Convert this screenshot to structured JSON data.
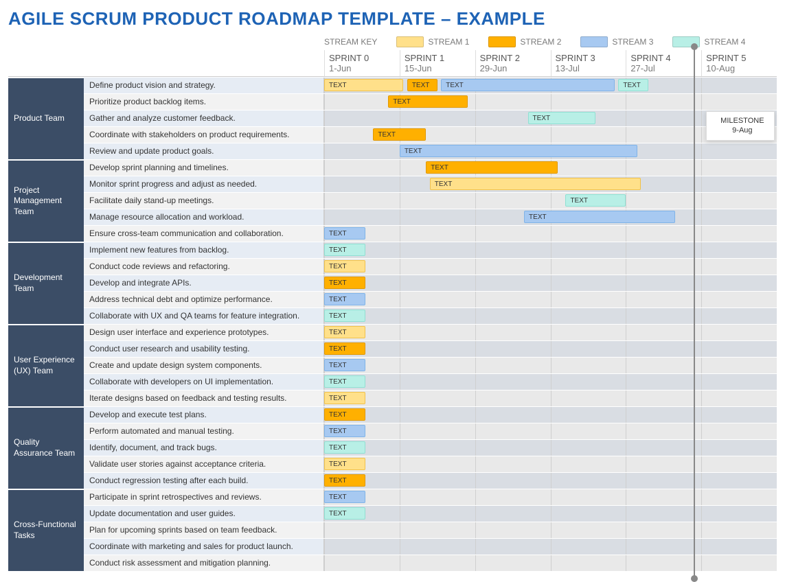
{
  "title": "AGILE SCRUM PRODUCT ROADMAP TEMPLATE – EXAMPLE",
  "legend": {
    "label": "STREAM KEY",
    "items": [
      {
        "name": "STREAM 1",
        "color": "#ffe08a"
      },
      {
        "name": "STREAM 2",
        "color": "#ffb000"
      },
      {
        "name": "STREAM 3",
        "color": "#a7c9f1"
      },
      {
        "name": "STREAM 4",
        "color": "#b8efe6"
      }
    ]
  },
  "sprints": [
    "SPRINT 0",
    "SPRINT 1",
    "SPRINT 2",
    "SPRINT 3",
    "SPRINT 4",
    "SPRINT 5"
  ],
  "dates": [
    "1-Jun",
    "15-Jun",
    "29-Jun",
    "13-Jul",
    "27-Jul",
    "10-Aug"
  ],
  "milestone": {
    "label": "MILESTONE",
    "date": "9-Aug",
    "sprint_position": 4.9
  },
  "groups": [
    {
      "name": "Product Team",
      "tasks": [
        "Define product vision and strategy.",
        "Prioritize product backlog items.",
        "Gather and analyze customer feedback.",
        "Coordinate with stakeholders on product requirements.",
        "Review and update product goals."
      ]
    },
    {
      "name": "Project Management Team",
      "tasks": [
        "Develop sprint planning and timelines.",
        "Monitor sprint progress and adjust as needed.",
        "Facilitate daily stand-up meetings.",
        "Manage resource allocation and workload.",
        "Ensure cross-team communication and collaboration."
      ]
    },
    {
      "name": "Development Team",
      "tasks": [
        "Implement new features from backlog.",
        "Conduct code reviews and refactoring.",
        "Develop and integrate APIs.",
        "Address technical debt and optimize performance.",
        "Collaborate with UX and QA teams for feature integration."
      ]
    },
    {
      "name": "User Experience (UX) Team",
      "tasks": [
        "Design user interface and experience prototypes.",
        "Conduct user research and usability testing.",
        "Create and update design system components.",
        "Collaborate with developers on UI implementation.",
        "Iterate designs based on feedback and testing results."
      ]
    },
    {
      "name": "Quality Assurance Team",
      "tasks": [
        "Develop and execute test plans.",
        "Perform automated and manual testing.",
        "Identify, document, and track bugs.",
        "Validate user stories against acceptance criteria.",
        "Conduct regression testing after each build."
      ]
    },
    {
      "name": "Cross-Functional Tasks",
      "tasks": [
        "Participate in sprint retrospectives and reviews.",
        "Update documentation and user guides.",
        "Plan for upcoming sprints based on team feedback.",
        "Coordinate with marketing and sales for product launch.",
        "Conduct risk assessment and mitigation planning."
      ]
    }
  ],
  "chart_data": {
    "type": "gantt",
    "x_unit": "sprint",
    "xlim": [
      0,
      6
    ],
    "bar_label": "TEXT",
    "bars": [
      {
        "row": 0,
        "stream": 1,
        "start": 0,
        "end": 1.05
      },
      {
        "row": 0,
        "stream": 2,
        "start": 1.1,
        "end": 1.5
      },
      {
        "row": 0,
        "stream": 3,
        "start": 1.55,
        "end": 3.85
      },
      {
        "row": 0,
        "stream": 4,
        "start": 3.9,
        "end": 4.3
      },
      {
        "row": 1,
        "stream": 2,
        "start": 0.85,
        "end": 1.9
      },
      {
        "row": 2,
        "stream": 4,
        "start": 2.7,
        "end": 3.6
      },
      {
        "row": 3,
        "stream": 2,
        "start": 0.65,
        "end": 1.35
      },
      {
        "row": 4,
        "stream": 3,
        "start": 1.0,
        "end": 4.15
      },
      {
        "row": 5,
        "stream": 2,
        "start": 1.35,
        "end": 3.1
      },
      {
        "row": 6,
        "stream": 1,
        "start": 1.4,
        "end": 4.2
      },
      {
        "row": 7,
        "stream": 4,
        "start": 3.2,
        "end": 4.0
      },
      {
        "row": 8,
        "stream": 3,
        "start": 2.65,
        "end": 4.65
      },
      {
        "row": 9,
        "stream": 3,
        "start": 0,
        "end": 0.55
      },
      {
        "row": 10,
        "stream": 4,
        "start": 0,
        "end": 0.55
      },
      {
        "row": 11,
        "stream": 1,
        "start": 0,
        "end": 0.55
      },
      {
        "row": 12,
        "stream": 2,
        "start": 0,
        "end": 0.55
      },
      {
        "row": 13,
        "stream": 3,
        "start": 0,
        "end": 0.55
      },
      {
        "row": 14,
        "stream": 4,
        "start": 0,
        "end": 0.55
      },
      {
        "row": 15,
        "stream": 1,
        "start": 0,
        "end": 0.55
      },
      {
        "row": 16,
        "stream": 2,
        "start": 0,
        "end": 0.55
      },
      {
        "row": 17,
        "stream": 3,
        "start": 0,
        "end": 0.55
      },
      {
        "row": 18,
        "stream": 4,
        "start": 0,
        "end": 0.55
      },
      {
        "row": 19,
        "stream": 1,
        "start": 0,
        "end": 0.55
      },
      {
        "row": 20,
        "stream": 2,
        "start": 0,
        "end": 0.55
      },
      {
        "row": 21,
        "stream": 3,
        "start": 0,
        "end": 0.55
      },
      {
        "row": 22,
        "stream": 4,
        "start": 0,
        "end": 0.55
      },
      {
        "row": 23,
        "stream": 1,
        "start": 0,
        "end": 0.55
      },
      {
        "row": 24,
        "stream": 2,
        "start": 0,
        "end": 0.55
      },
      {
        "row": 25,
        "stream": 3,
        "start": 0,
        "end": 0.55
      },
      {
        "row": 26,
        "stream": 4,
        "start": 0,
        "end": 0.55
      }
    ]
  }
}
